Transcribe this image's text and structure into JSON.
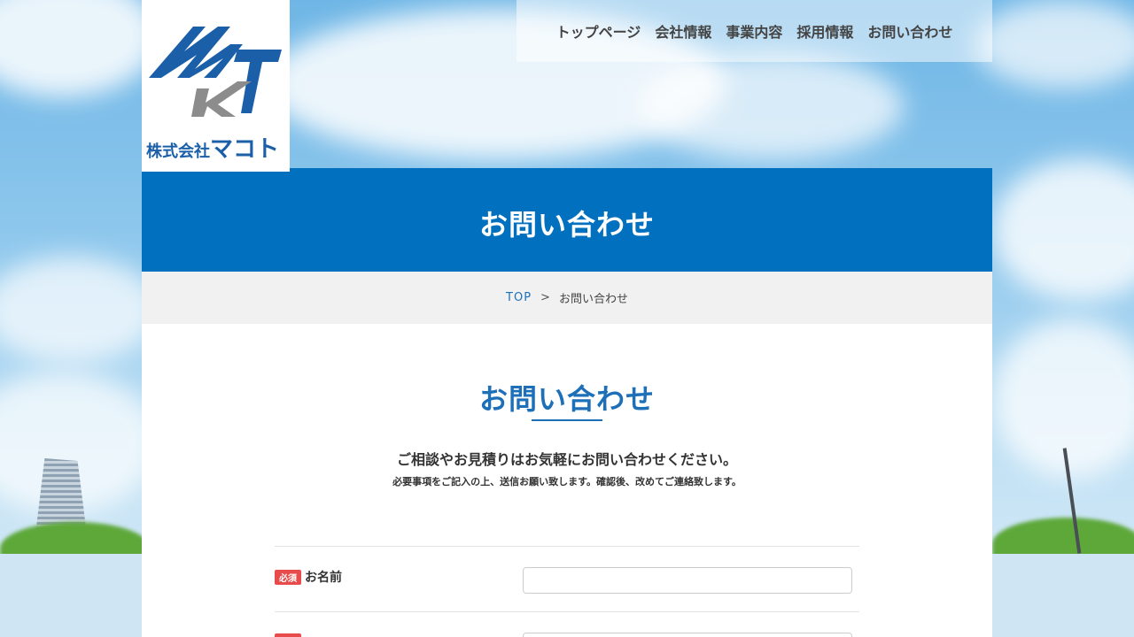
{
  "logo": {
    "company_prefix": "株式会社",
    "company_name": "マコト"
  },
  "nav": {
    "items": [
      "トップページ",
      "会社情報",
      "事業内容",
      "採用情報",
      "お問い合わせ"
    ]
  },
  "hero": {
    "title": "お問い合わせ"
  },
  "breadcrumb": {
    "home": "TOP",
    "separator": ">",
    "current": "お問い合わせ"
  },
  "section": {
    "title": "お問い合わせ",
    "lead": "ご相談やお見積りはお気軽にお問い合わせください。",
    "sublead": "必要事項をご記入の上、送信お願い致します。確認後、改めてご連絡致します。"
  },
  "form": {
    "required_badge": "必須",
    "fields": [
      {
        "label": "お名前",
        "value": ""
      }
    ]
  },
  "colors": {
    "brand_blue": "#0070bf",
    "accent_blue": "#1d6fb8",
    "required_red": "#e84b4b"
  }
}
